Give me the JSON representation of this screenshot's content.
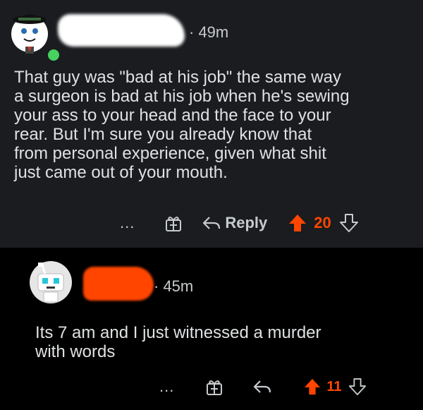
{
  "comments": [
    {
      "time": "· 49m",
      "body": "That guy was \"bad at his job\" the same way\na surgeon is bad at his job when he's sewing\nyour ass to your head and the face to your\nrear. But I'm sure you already know that\nfrom personal experience, given what shit\njust came out of your mouth.",
      "more": "...",
      "reply_label": "Reply",
      "score": "20"
    },
    {
      "time": "· 45m",
      "body": "Its 7 am and I just witnessed a murder\nwith words",
      "more": "...",
      "score": "11"
    }
  ],
  "colors": {
    "upvote": "#ff4500",
    "online": "#46d160",
    "comment1_bg": "#1a1c1f",
    "comment2_bg": "#000000"
  },
  "icons": {
    "award": "gift-icon",
    "reply": "reply-arrow-icon",
    "upvote": "upvote-arrow-icon",
    "downvote": "downvote-arrow-icon"
  }
}
